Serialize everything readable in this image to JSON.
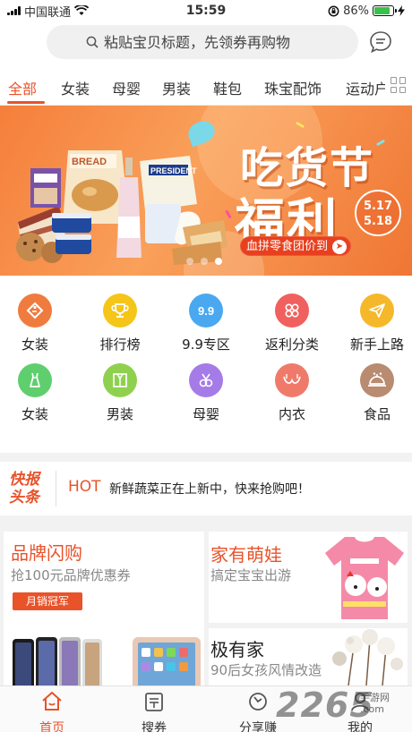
{
  "status_bar": {
    "carrier": "中国联通",
    "time": "15:59",
    "battery": "86%",
    "battery_level": 0.86
  },
  "search": {
    "placeholder": "粘贴宝贝标题，先领券再购物",
    "icon": "search-icon",
    "message_icon": "message-icon"
  },
  "tabs": {
    "items": [
      "全部",
      "女装",
      "母婴",
      "男装",
      "鞋包",
      "珠宝配饰",
      "运动户外"
    ],
    "active_index": 0,
    "more_icon": "grid-icon"
  },
  "banner": {
    "title_line1": "吃货节",
    "title_line2": "福利",
    "date_line1": "5.17",
    "date_line2": "5.18",
    "cta": "血拼零食团价到",
    "page_count": 3,
    "active_page": 2,
    "product_labels": {
      "bread": "BREAD",
      "butter": "PRESIDENT"
    }
  },
  "quick_entries": [
    {
      "label": "女装",
      "icon": "tag-icon",
      "color": "#f07b3f"
    },
    {
      "label": "排行榜",
      "icon": "trophy-icon",
      "color": "#f5c518"
    },
    {
      "label": "9.9专区",
      "icon": "nine-nine-icon",
      "color": "#4aa8f0"
    },
    {
      "label": "返利分类",
      "icon": "category-icon",
      "color": "#f0605e"
    },
    {
      "label": "新手上路",
      "icon": "paper-plane-icon",
      "color": "#f5b82a"
    },
    {
      "label": "女装",
      "icon": "dress-icon",
      "color": "#5fcf6e"
    },
    {
      "label": "男装",
      "icon": "shirt-icon",
      "color": "#8fd14f"
    },
    {
      "label": "母婴",
      "icon": "pacifier-icon",
      "color": "#a57be8"
    },
    {
      "label": "内衣",
      "icon": "bra-icon",
      "color": "#f07a6a"
    },
    {
      "label": "食品",
      "icon": "food-icon",
      "color": "#b98b70"
    }
  ],
  "ticker": {
    "logo_line1": "快报",
    "logo_line2": "头条",
    "tag": "HOT",
    "text": "新鲜蔬菜正在上新中，快来抢购吧！"
  },
  "promos": {
    "brand": {
      "title": "品牌闪购",
      "subtitle": "抢100元品牌优惠券",
      "badge": "月销冠军",
      "title_color": "#e8532a"
    },
    "baby": {
      "title": "家有萌娃",
      "subtitle": "搞定宝宝出游",
      "title_color": "#e8532a"
    },
    "home": {
      "title": "极有家",
      "subtitle": "90后女孩风情改造",
      "title_color": "#222222"
    }
  },
  "tabbar": {
    "items": [
      {
        "label": "首页",
        "icon": "home-icon"
      },
      {
        "label": "搜券",
        "icon": "coupon-icon"
      },
      {
        "label": "分享赚",
        "icon": "share-icon"
      },
      {
        "label": "我的",
        "icon": "profile-icon"
      }
    ],
    "active_index": 0
  },
  "watermark": {
    "text": "2265",
    "suffix": ".com",
    "label": "手游网"
  },
  "colors": {
    "accent": "#e8532a",
    "banner": "#f5883f"
  }
}
